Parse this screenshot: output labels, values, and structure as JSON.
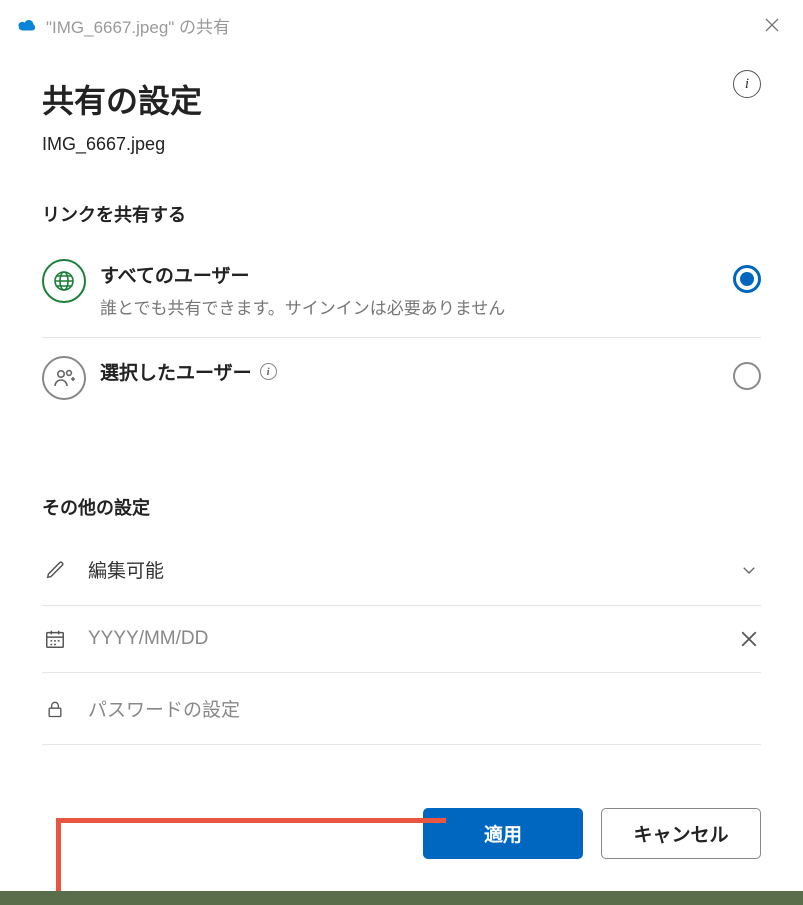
{
  "titlebar": {
    "text": "\"IMG_6667.jpeg\" の共有"
  },
  "header": {
    "title": "共有の設定",
    "filename": "IMG_6667.jpeg"
  },
  "share": {
    "section_label": "リンクを共有する",
    "options": [
      {
        "title": "すべてのユーザー",
        "subtitle": "誰とでも共有できます。サインインは必要ありません",
        "selected": true
      },
      {
        "title": "選択したユーザー",
        "subtitle": "",
        "selected": false,
        "has_info": true
      }
    ]
  },
  "other": {
    "section_label": "その他の設定",
    "permission_value": "編集可能",
    "date_placeholder": "YYYY/MM/DD",
    "password_placeholder": "パスワードの設定"
  },
  "footer": {
    "apply": "適用",
    "cancel": "キャンセル"
  }
}
